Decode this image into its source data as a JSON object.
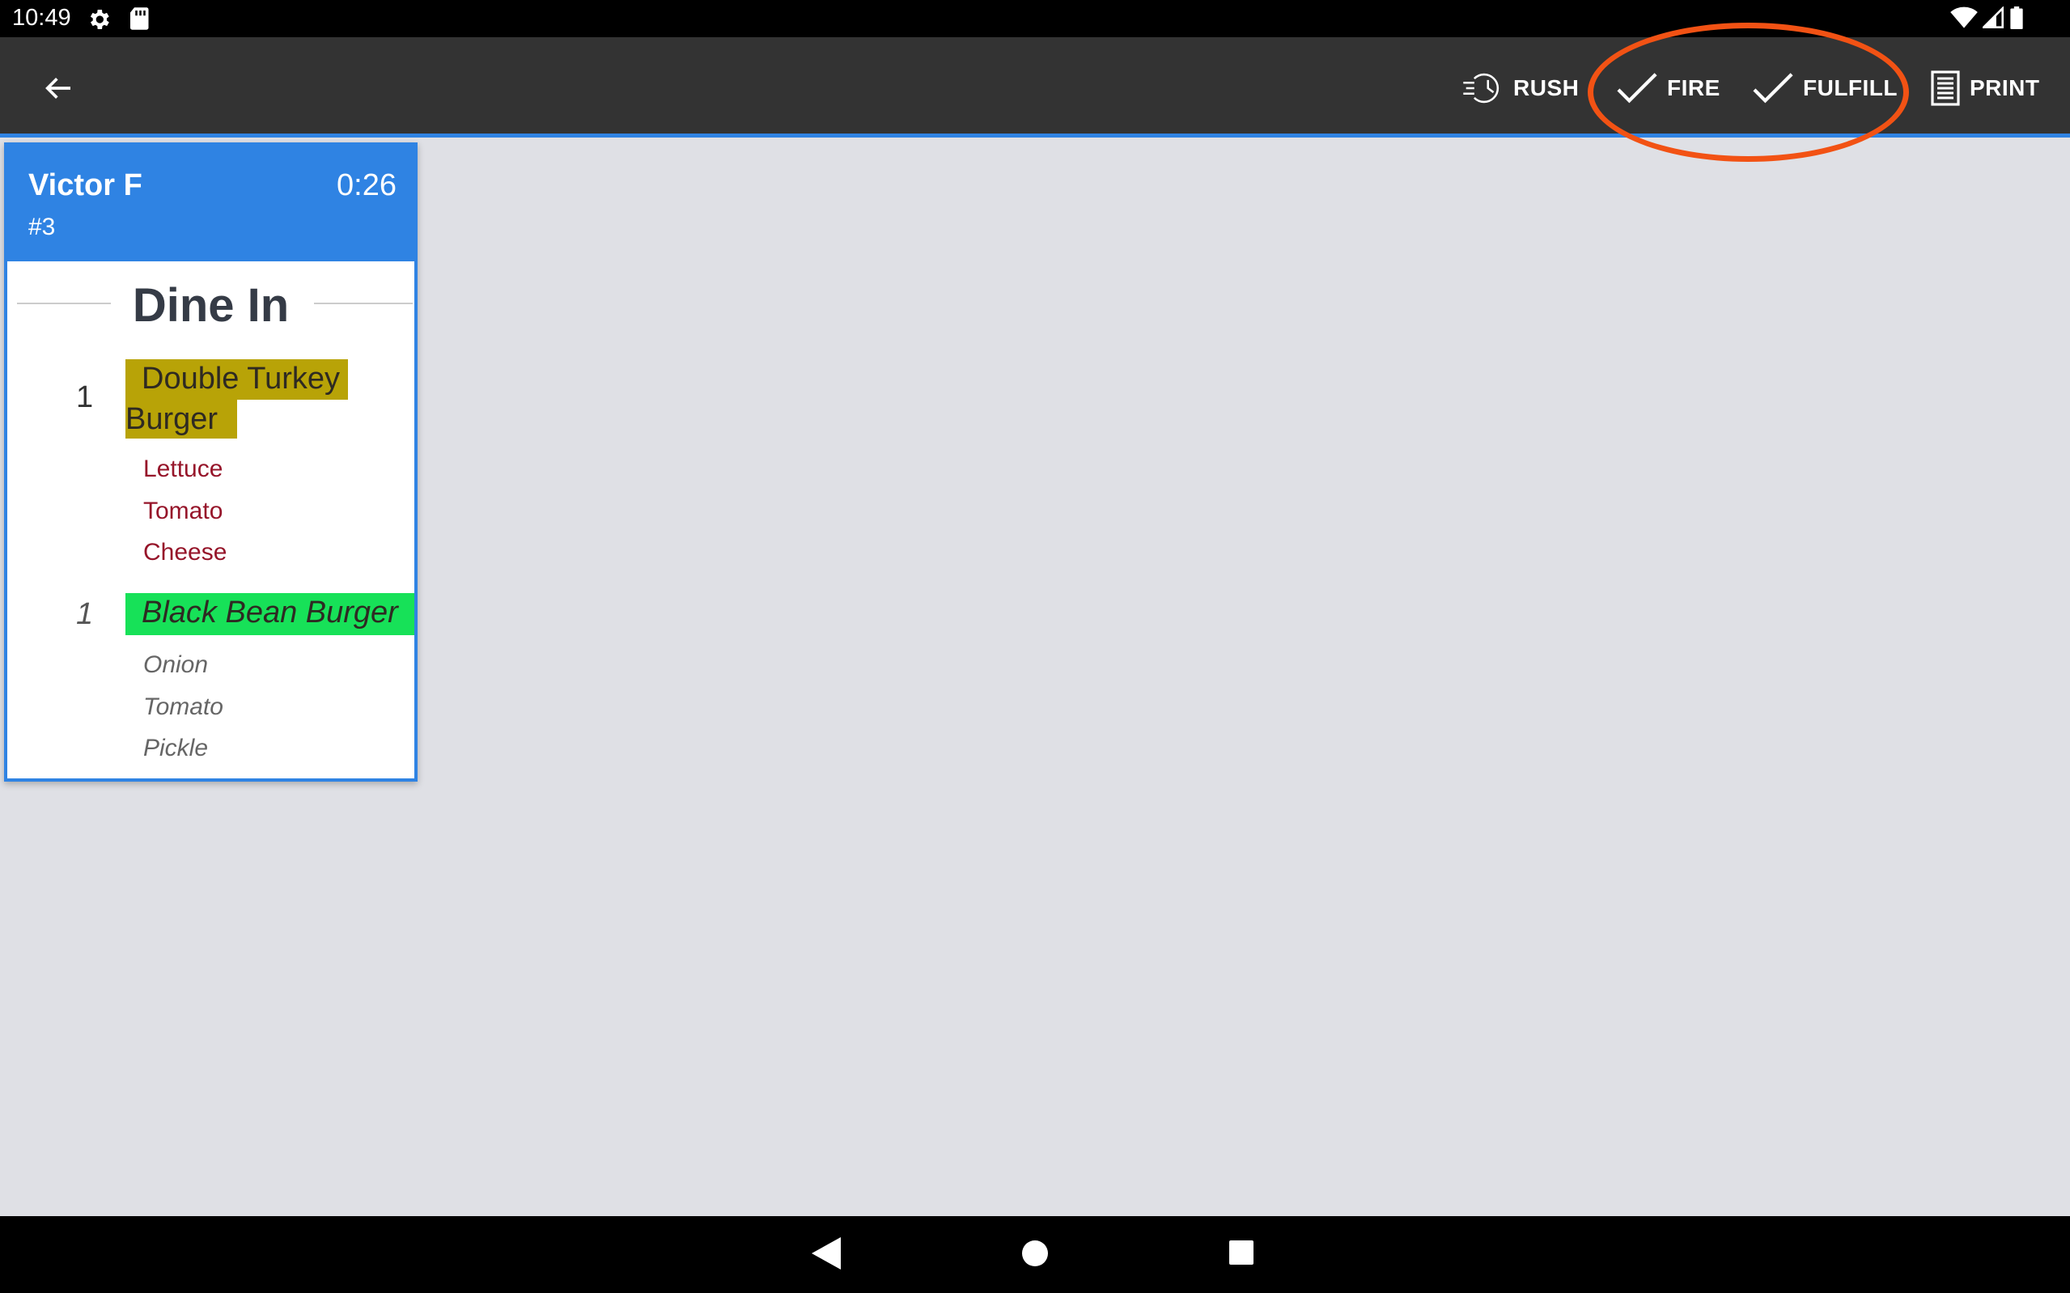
{
  "status_bar": {
    "time": "10:49",
    "icons": [
      "settings-icon",
      "sd-card-icon",
      "wifi-icon",
      "signal-icon",
      "battery-icon"
    ]
  },
  "toolbar": {
    "back_icon": "arrow-back-icon",
    "actions": [
      {
        "label": "RUSH",
        "icon": "rush-clock-icon"
      },
      {
        "label": "FIRE",
        "icon": "check-icon"
      },
      {
        "label": "FULFILL",
        "icon": "check-icon"
      },
      {
        "label": "PRINT",
        "icon": "print-icon"
      }
    ],
    "highlight_color": "#f25214"
  },
  "ticket": {
    "customer": "Victor F",
    "order_number": "#3",
    "elapsed": "0:26",
    "order_type": "Dine In",
    "header_color": "#2f83e3",
    "items": [
      {
        "qty": "1",
        "name_line1": "Double Turkey",
        "name_line2": "Burger",
        "highlight": "#b8a307",
        "modifiers": [
          "Lettuce",
          "Tomato",
          "Cheese"
        ]
      },
      {
        "qty": "1",
        "name": "Black Bean Burger",
        "highlight": "#17e158",
        "modifiers": [
          "Onion",
          "Tomato",
          "Pickle"
        ]
      }
    ]
  },
  "nav_bar": {
    "buttons": [
      "back-triangle-icon",
      "home-circle-icon",
      "recents-square-icon"
    ]
  }
}
